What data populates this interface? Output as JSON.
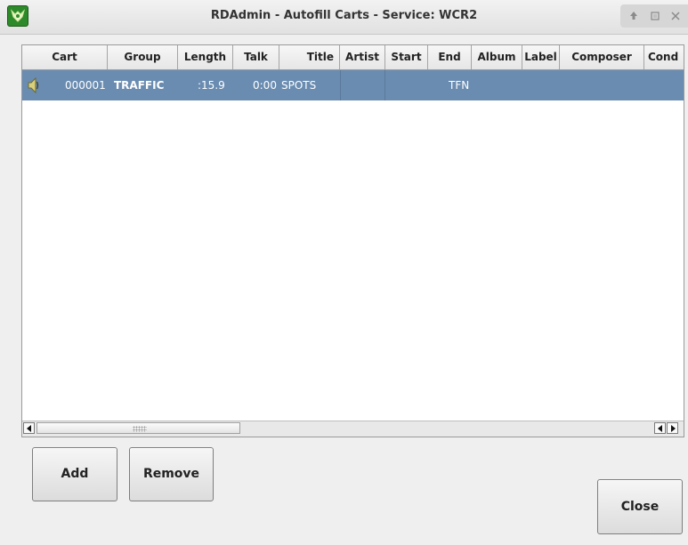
{
  "window": {
    "title": "RDAdmin - Autofill Carts - Service: WCR2",
    "app_icon": "rivendell-icon",
    "controls": [
      "up-arrow-icon",
      "maximize-icon",
      "close-icon"
    ]
  },
  "table": {
    "columns": [
      "Cart",
      "Group",
      "Length",
      "Talk",
      "Title",
      "Artist",
      "Start",
      "End",
      "Album",
      "Label",
      "Composer",
      "Cond"
    ],
    "rows": [
      {
        "icon": "speaker-icon",
        "cart": "000001",
        "group": "TRAFFIC",
        "length": ":15.9",
        "talk": "0:00",
        "title": "SPOTS",
        "artist": "",
        "start": "",
        "end": "TFN",
        "album": "",
        "label": "",
        "composer": "",
        "cond": ""
      }
    ],
    "selected_row_color": "#6a8cb1"
  },
  "buttons": {
    "add": "Add",
    "remove": "Remove",
    "close": "Close"
  }
}
